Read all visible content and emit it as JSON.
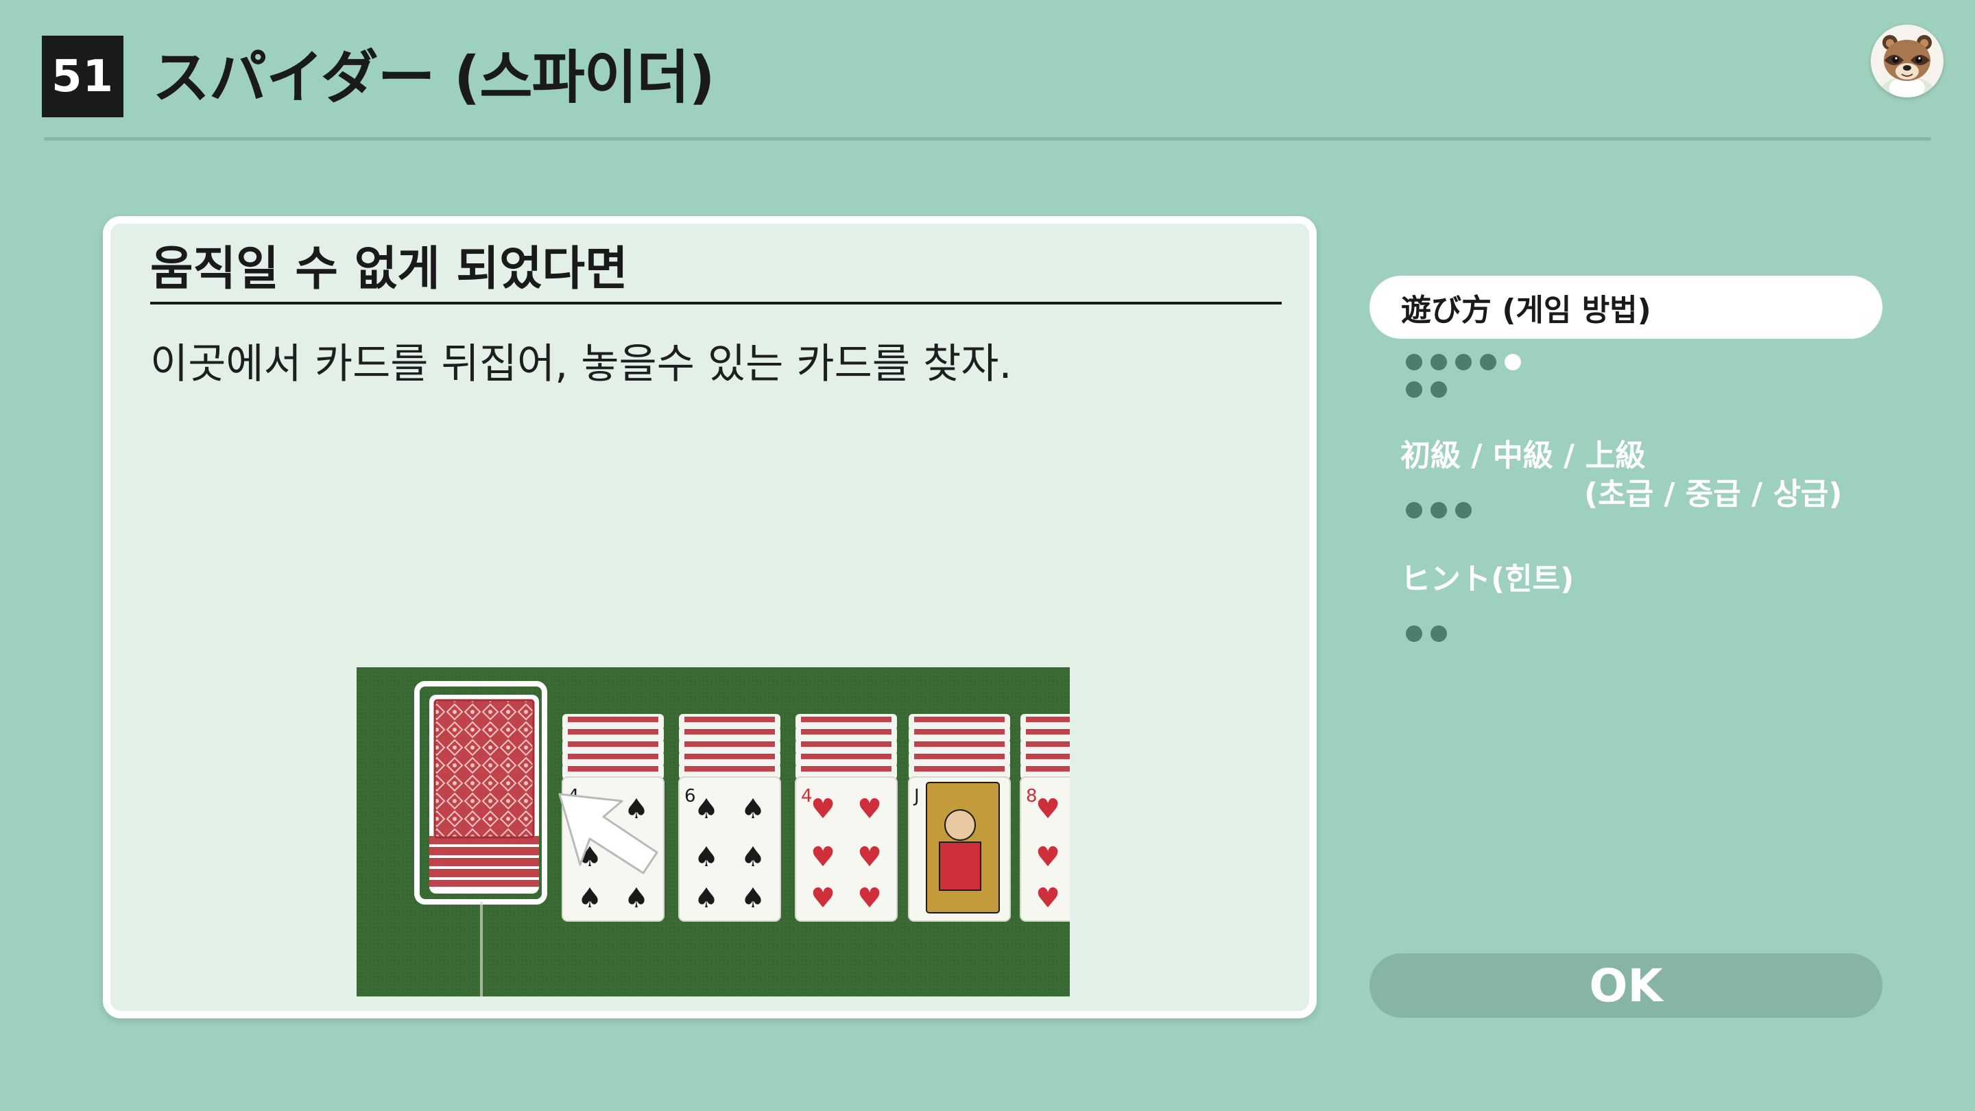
{
  "header": {
    "game_number": "51",
    "title": "スパイダー (스파이더)"
  },
  "panel": {
    "heading": "움직일 수 없게 되었다면",
    "description": "이곳에서 카드를 뒤집어, 놓을수 있는 카드를 찾자."
  },
  "illustration": {
    "tableau": [
      {
        "rank": "4",
        "suit": "♠"
      },
      {
        "rank": "6",
        "suit": "♠"
      },
      {
        "rank": "4",
        "suit": "♥"
      },
      {
        "rank": "J",
        "suit": "♠"
      },
      {
        "rank": "8",
        "suit": "♥"
      }
    ],
    "highlight_color": "#ffffff",
    "felt_color": "#3b6b34",
    "card_back_color": "#c0424a"
  },
  "menu": {
    "items": [
      {
        "label": "遊び方 (게임 방법)",
        "active": true,
        "dot_count": 7,
        "current_dot": 4
      },
      {
        "label_line1": "初級 / 中級 / 上級",
        "label_line2": "(초급 / 중급 / 상급)",
        "active": false,
        "dot_count": 3
      },
      {
        "label": "ヒント(힌트)",
        "active": false,
        "dot_count": 2
      }
    ]
  },
  "ok_button": {
    "label": "OK"
  },
  "colors": {
    "background": "#9dd0bd",
    "panel": "#e3f0e7",
    "dot": "#4b7f6b",
    "dot_current": "#ffffff",
    "ok_button": "#86b5a3"
  }
}
